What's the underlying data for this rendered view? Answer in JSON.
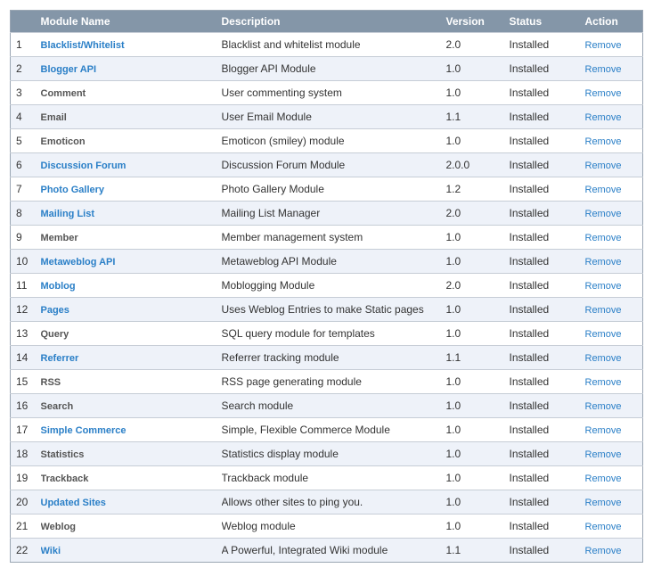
{
  "table": {
    "headers": {
      "number": "",
      "name": "Module Name",
      "description": "Description",
      "version": "Version",
      "status": "Status",
      "action": "Action"
    },
    "rows": [
      {
        "number": "1",
        "name": "Blacklist/Whitelist",
        "linked": true,
        "description": "Blacklist and whitelist module",
        "version": "2.0",
        "status": "Installed",
        "action": "Remove"
      },
      {
        "number": "2",
        "name": "Blogger API",
        "linked": true,
        "description": "Blogger API Module",
        "version": "1.0",
        "status": "Installed",
        "action": "Remove"
      },
      {
        "number": "3",
        "name": "Comment",
        "linked": false,
        "description": "User commenting system",
        "version": "1.0",
        "status": "Installed",
        "action": "Remove"
      },
      {
        "number": "4",
        "name": "Email",
        "linked": false,
        "description": "User Email Module",
        "version": "1.1",
        "status": "Installed",
        "action": "Remove"
      },
      {
        "number": "5",
        "name": "Emoticon",
        "linked": false,
        "description": "Emoticon (smiley) module",
        "version": "1.0",
        "status": "Installed",
        "action": "Remove"
      },
      {
        "number": "6",
        "name": "Discussion Forum",
        "linked": true,
        "description": "Discussion Forum Module",
        "version": "2.0.0",
        "status": "Installed",
        "action": "Remove"
      },
      {
        "number": "7",
        "name": "Photo Gallery",
        "linked": true,
        "description": "Photo Gallery Module",
        "version": "1.2",
        "status": "Installed",
        "action": "Remove"
      },
      {
        "number": "8",
        "name": "Mailing List",
        "linked": true,
        "description": "Mailing List Manager",
        "version": "2.0",
        "status": "Installed",
        "action": "Remove"
      },
      {
        "number": "9",
        "name": "Member",
        "linked": false,
        "description": "Member management system",
        "version": "1.0",
        "status": "Installed",
        "action": "Remove"
      },
      {
        "number": "10",
        "name": "Metaweblog API",
        "linked": true,
        "description": "Metaweblog API Module",
        "version": "1.0",
        "status": "Installed",
        "action": "Remove"
      },
      {
        "number": "11",
        "name": "Moblog",
        "linked": true,
        "description": "Moblogging Module",
        "version": "2.0",
        "status": "Installed",
        "action": "Remove"
      },
      {
        "number": "12",
        "name": "Pages",
        "linked": true,
        "description": "Uses Weblog Entries to make Static pages",
        "version": "1.0",
        "status": "Installed",
        "action": "Remove"
      },
      {
        "number": "13",
        "name": "Query",
        "linked": false,
        "description": "SQL query module for templates",
        "version": "1.0",
        "status": "Installed",
        "action": "Remove"
      },
      {
        "number": "14",
        "name": "Referrer",
        "linked": true,
        "description": "Referrer tracking module",
        "version": "1.1",
        "status": "Installed",
        "action": "Remove"
      },
      {
        "number": "15",
        "name": "RSS",
        "linked": false,
        "description": "RSS page generating module",
        "version": "1.0",
        "status": "Installed",
        "action": "Remove"
      },
      {
        "number": "16",
        "name": "Search",
        "linked": false,
        "description": "Search module",
        "version": "1.0",
        "status": "Installed",
        "action": "Remove"
      },
      {
        "number": "17",
        "name": "Simple Commerce",
        "linked": true,
        "description": "Simple, Flexible Commerce Module",
        "version": "1.0",
        "status": "Installed",
        "action": "Remove"
      },
      {
        "number": "18",
        "name": "Statistics",
        "linked": false,
        "description": "Statistics display module",
        "version": "1.0",
        "status": "Installed",
        "action": "Remove"
      },
      {
        "number": "19",
        "name": "Trackback",
        "linked": false,
        "description": "Trackback module",
        "version": "1.0",
        "status": "Installed",
        "action": "Remove"
      },
      {
        "number": "20",
        "name": "Updated Sites",
        "linked": true,
        "description": "Allows other sites to ping you.",
        "version": "1.0",
        "status": "Installed",
        "action": "Remove"
      },
      {
        "number": "21",
        "name": "Weblog",
        "linked": false,
        "description": "Weblog module",
        "version": "1.0",
        "status": "Installed",
        "action": "Remove"
      },
      {
        "number": "22",
        "name": "Wiki",
        "linked": true,
        "description": "A Powerful, Integrated Wiki module",
        "version": "1.1",
        "status": "Installed",
        "action": "Remove"
      }
    ]
  },
  "colors": {
    "header_bg": "#8496a8",
    "link": "#2a7fc7",
    "installed": "#1a9c2c",
    "row_alt": "#eef2f9"
  }
}
